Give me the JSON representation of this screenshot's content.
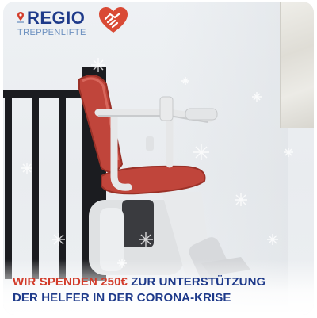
{
  "brand": {
    "name": "REGIO",
    "tagline": "TREPPENLIFTE"
  },
  "icons": {
    "location": "location-pin-icon",
    "heart": "heart-handshake-icon"
  },
  "headline": {
    "line1_red": "WIR SPENDEN 250€",
    "line1_blue": " ZUR UNTERSTÜTZUNG",
    "line2_blue": "DER HELFER IN DER CORONA-KRISE"
  },
  "colors": {
    "brand_blue": "#1e3a8a",
    "brand_red": "#d23b2a",
    "seat_red": "#c0453b"
  }
}
